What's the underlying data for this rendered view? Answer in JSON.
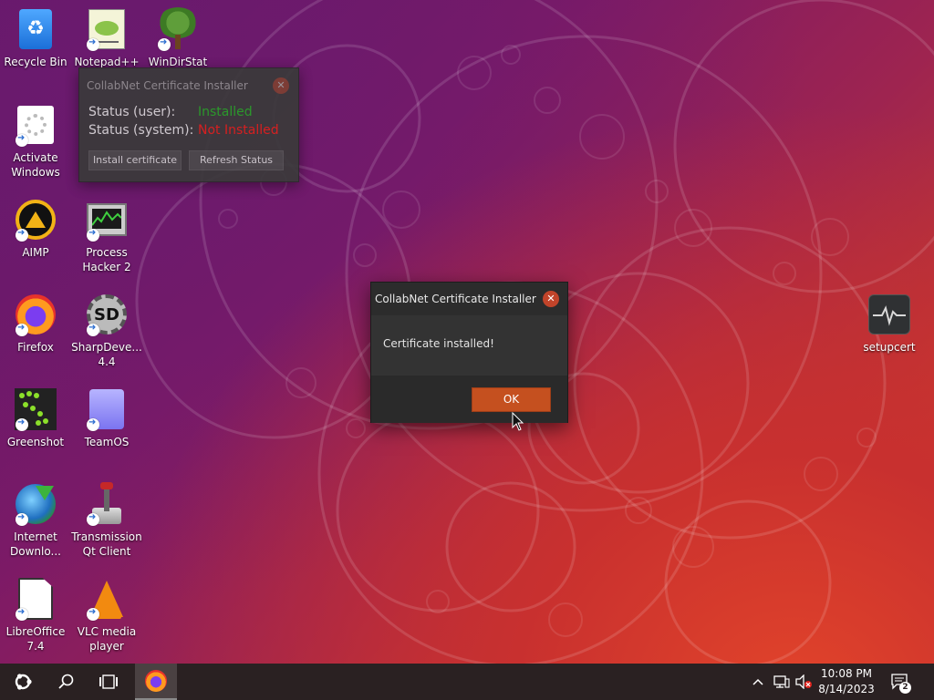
{
  "desktop": {
    "icons": [
      {
        "id": "recycle-bin",
        "label": "Recycle Bin"
      },
      {
        "id": "notepadpp",
        "label": "Notepad++"
      },
      {
        "id": "windirstat",
        "label": "WinDirStat"
      },
      {
        "id": "activate-windows",
        "label": "Activate Windows"
      },
      {
        "id": "aimp",
        "label": "AIMP"
      },
      {
        "id": "process-hacker",
        "label": "Process Hacker 2"
      },
      {
        "id": "firefox",
        "label": "Firefox"
      },
      {
        "id": "sharpdevelop",
        "label": "SharpDeve... 4.4"
      },
      {
        "id": "greenshot",
        "label": "Greenshot"
      },
      {
        "id": "teamos",
        "label": "TeamOS"
      },
      {
        "id": "internet-download",
        "label": "Internet Downlo..."
      },
      {
        "id": "transmission",
        "label": "Transmission Qt Client"
      },
      {
        "id": "libreoffice",
        "label": "LibreOffice 7.4"
      },
      {
        "id": "vlc",
        "label": "VLC media player"
      },
      {
        "id": "setupcert",
        "label": "setupcert"
      }
    ]
  },
  "installer_window": {
    "title": "CollabNet Certificate Installer",
    "status_user_label": "Status (user):",
    "status_user_value": "Installed",
    "status_system_label": "Status (system):",
    "status_system_value": "Not Installed",
    "install_button": "Install certificate",
    "refresh_button": "Refresh Status",
    "close_icon": "close-icon"
  },
  "dialog": {
    "title": "CollabNet Certificate Installer",
    "message": "Certificate installed!",
    "ok_button": "OK",
    "close_icon": "close-icon"
  },
  "taskbar": {
    "start_icon": "ubuntu-start-icon",
    "search_icon": "search-icon",
    "task_view_icon": "task-view-icon",
    "pinned_app": "firefox-icon",
    "tray": {
      "chevron": "chevron-up-icon",
      "network": "network-icon",
      "volume": "volume-muted-icon",
      "time": "10:08 PM",
      "date": "8/14/2023",
      "notifications_count": "2"
    }
  },
  "colors": {
    "accent": "#c5501f",
    "installed": "#26a326",
    "not_installed": "#e0201a",
    "taskbar": "#2a2122"
  }
}
